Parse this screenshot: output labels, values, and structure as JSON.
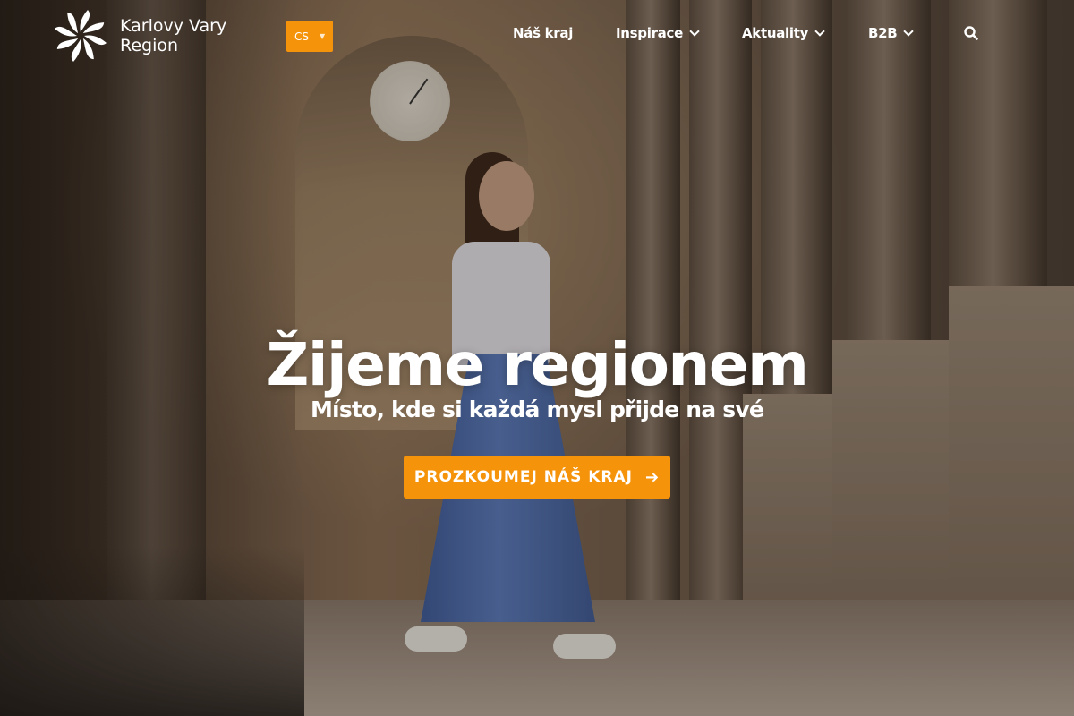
{
  "brand": {
    "name_line1": "Karlovy Vary",
    "name_line2": "Region"
  },
  "language": {
    "selected": "CS"
  },
  "nav": {
    "items": [
      {
        "label": "Náš kraj",
        "has_dropdown": false
      },
      {
        "label": "Inspirace",
        "has_dropdown": true
      },
      {
        "label": "Aktuality",
        "has_dropdown": true
      },
      {
        "label": "B2B",
        "has_dropdown": true
      }
    ],
    "search_icon": "search-icon"
  },
  "hero": {
    "title": "Žijeme regionem",
    "subtitle": "Místo, kde si každá mysl přijde na své",
    "cta_label": "PROZKOUMEJ NÁŠ KRAJ",
    "cta_icon": "arrow-right-icon"
  },
  "colors": {
    "accent": "#f5930a",
    "text": "#ffffff"
  }
}
